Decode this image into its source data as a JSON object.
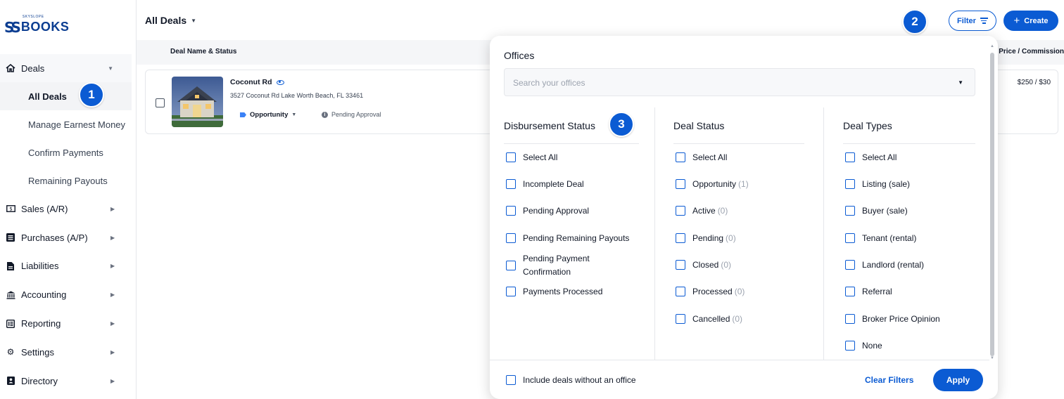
{
  "logo": {
    "small": "SKYSLOPE",
    "big": "BOOKS"
  },
  "sidebar": {
    "deals_label": "Deals",
    "sub_items": [
      "All Deals",
      "Manage Earnest Money",
      "Confirm Payments",
      "Remaining Payouts"
    ],
    "items": [
      {
        "label": "Sales (A/R)",
        "icon": "dollar-bill-icon"
      },
      {
        "label": "Purchases (A/P)",
        "icon": "list-icon"
      },
      {
        "label": "Liabilities",
        "icon": "document-icon"
      },
      {
        "label": "Accounting",
        "icon": "bank-icon"
      },
      {
        "label": "Reporting",
        "icon": "report-icon"
      },
      {
        "label": "Settings",
        "icon": "gear-icon"
      },
      {
        "label": "Directory",
        "icon": "contact-book-icon"
      }
    ]
  },
  "badges": [
    "1",
    "2",
    "3"
  ],
  "header": {
    "title": "All Deals",
    "filter_label": "Filter",
    "create_label": "Create"
  },
  "table": {
    "col_deal": "Deal Name & Status",
    "col_price": "Price / Commission",
    "row": {
      "name": "Coconut Rd",
      "address": "3527 Coconut Rd Lake Worth Beach, FL 33461",
      "status": "Opportunity",
      "approval": "Pending Approval",
      "price": "$250 / $30"
    }
  },
  "filter": {
    "offices_title": "Offices",
    "offices_placeholder": "Search your offices",
    "disbursement": {
      "title": "Disbursement Status",
      "options": [
        "Select All",
        "Incomplete Deal",
        "Pending Approval",
        "Pending Remaining Payouts",
        "Pending Payment",
        "Confirmation",
        "Payments Processed"
      ]
    },
    "deal_status": {
      "title": "Deal Status",
      "options": [
        {
          "label": "Select All",
          "count": ""
        },
        {
          "label": "Opportunity",
          "count": "(1)"
        },
        {
          "label": "Active",
          "count": "(0)"
        },
        {
          "label": "Pending",
          "count": "(0)"
        },
        {
          "label": "Closed",
          "count": "(0)"
        },
        {
          "label": "Processed",
          "count": "(0)"
        },
        {
          "label": "Cancelled",
          "count": "(0)"
        }
      ]
    },
    "deal_types": {
      "title": "Deal Types",
      "options": [
        "Select All",
        "Listing (sale)",
        "Buyer (sale)",
        "Tenant (rental)",
        "Landlord (rental)",
        "Referral",
        "Broker Price Opinion",
        "None"
      ]
    },
    "include_label": "Include deals without an office",
    "clear_label": "Clear Filters",
    "apply_label": "Apply"
  },
  "colors": {
    "accent": "#0b5bd3",
    "brand": "#0b3d91"
  }
}
